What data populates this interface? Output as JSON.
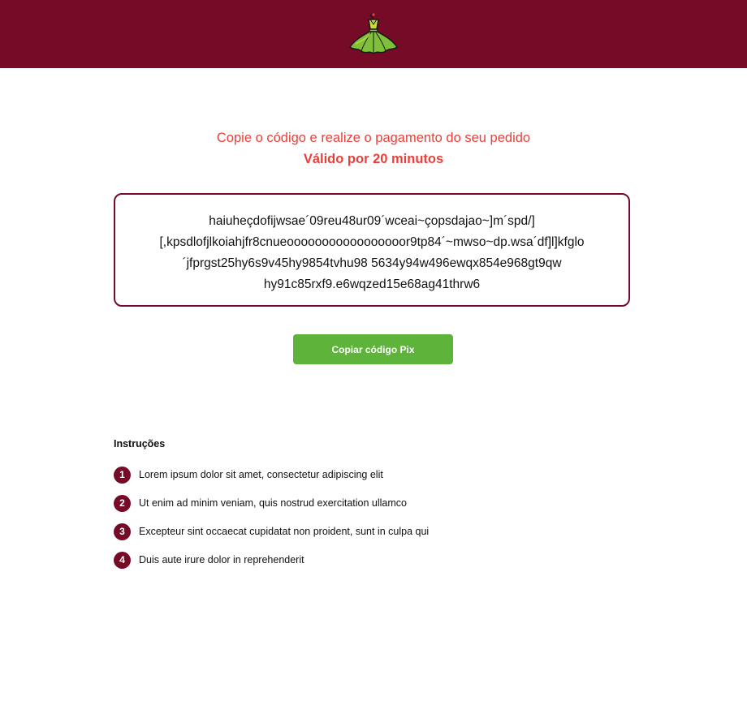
{
  "colors": {
    "header_bg": "#760b27",
    "accent_red": "#e8403a",
    "button_green": "#5eb33a",
    "step_badge": "#760b27"
  },
  "header": {
    "logo_icon": "green-dress-logo-icon"
  },
  "payment": {
    "headline": "Copie o código e realize o pagamento do seu pedido",
    "validity": "Válido por 20 minutos",
    "code_lines": [
      "haiuheçdofijwsae´09reu48ur09´wceai~çopsdajao~]m´spd/]",
      "[,kpsdlofjlkoiahjfr8cnueooooooooooooooooor9tp84´~mwso~dp.wsa´df]l]kfglo",
      "´jfprgst25hy6s9v45hy9854tvhu98 5634y94w496ewqx854e968gt9qw",
      "hy91c85rxf9.e6wqzed15e68ag41thrw6"
    ],
    "copy_button_label": "Copiar código Pix"
  },
  "instructions": {
    "title": "Instruções",
    "steps": [
      {
        "number": "1",
        "text": "Lorem ipsum dolor sit amet, consectetur adipiscing elit"
      },
      {
        "number": "2",
        "text": "Ut enim ad minim veniam, quis nostrud exercitation ullamco"
      },
      {
        "number": "3",
        "text": "Excepteur sint occaecat cupidatat non proident, sunt in culpa qui"
      },
      {
        "number": "4",
        "text": "Duis aute irure dolor in reprehenderit"
      }
    ]
  }
}
